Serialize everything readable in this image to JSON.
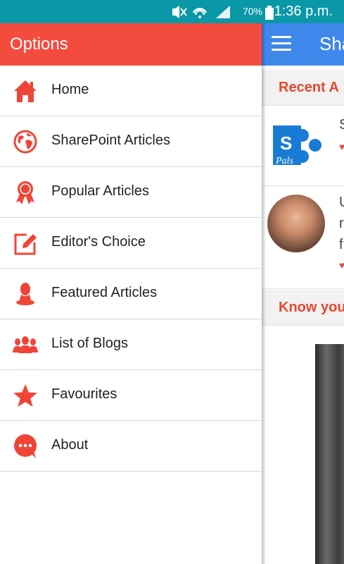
{
  "status": {
    "battery": "70%",
    "time": "1:36 p.m."
  },
  "drawer": {
    "title": "Options"
  },
  "menu": [
    {
      "label": "Home",
      "icon": "home-icon"
    },
    {
      "label": "SharePoint Articles",
      "icon": "globe-icon"
    },
    {
      "label": "Popular Articles",
      "icon": "award-ribbon-icon"
    },
    {
      "label": "Editor's Choice",
      "icon": "edit-icon"
    },
    {
      "label": "Featured Articles",
      "icon": "person-icon"
    },
    {
      "label": "List of Blogs",
      "icon": "group-icon"
    },
    {
      "label": "Favourites",
      "icon": "star-icon"
    },
    {
      "label": "About",
      "icon": "chat-bubble-icon"
    }
  ],
  "app": {
    "title_partial": "Sha",
    "recent_header": "Recent A",
    "article1": {
      "text": "S"
    },
    "article2": {
      "lines": [
        "U",
        "r",
        "f"
      ]
    },
    "know_header": "Know you"
  },
  "colors": {
    "status_bar": "#0a98a7",
    "drawer_header": "#f34c3f",
    "app_bar": "#3f87ea",
    "accent": "#e8472f"
  }
}
